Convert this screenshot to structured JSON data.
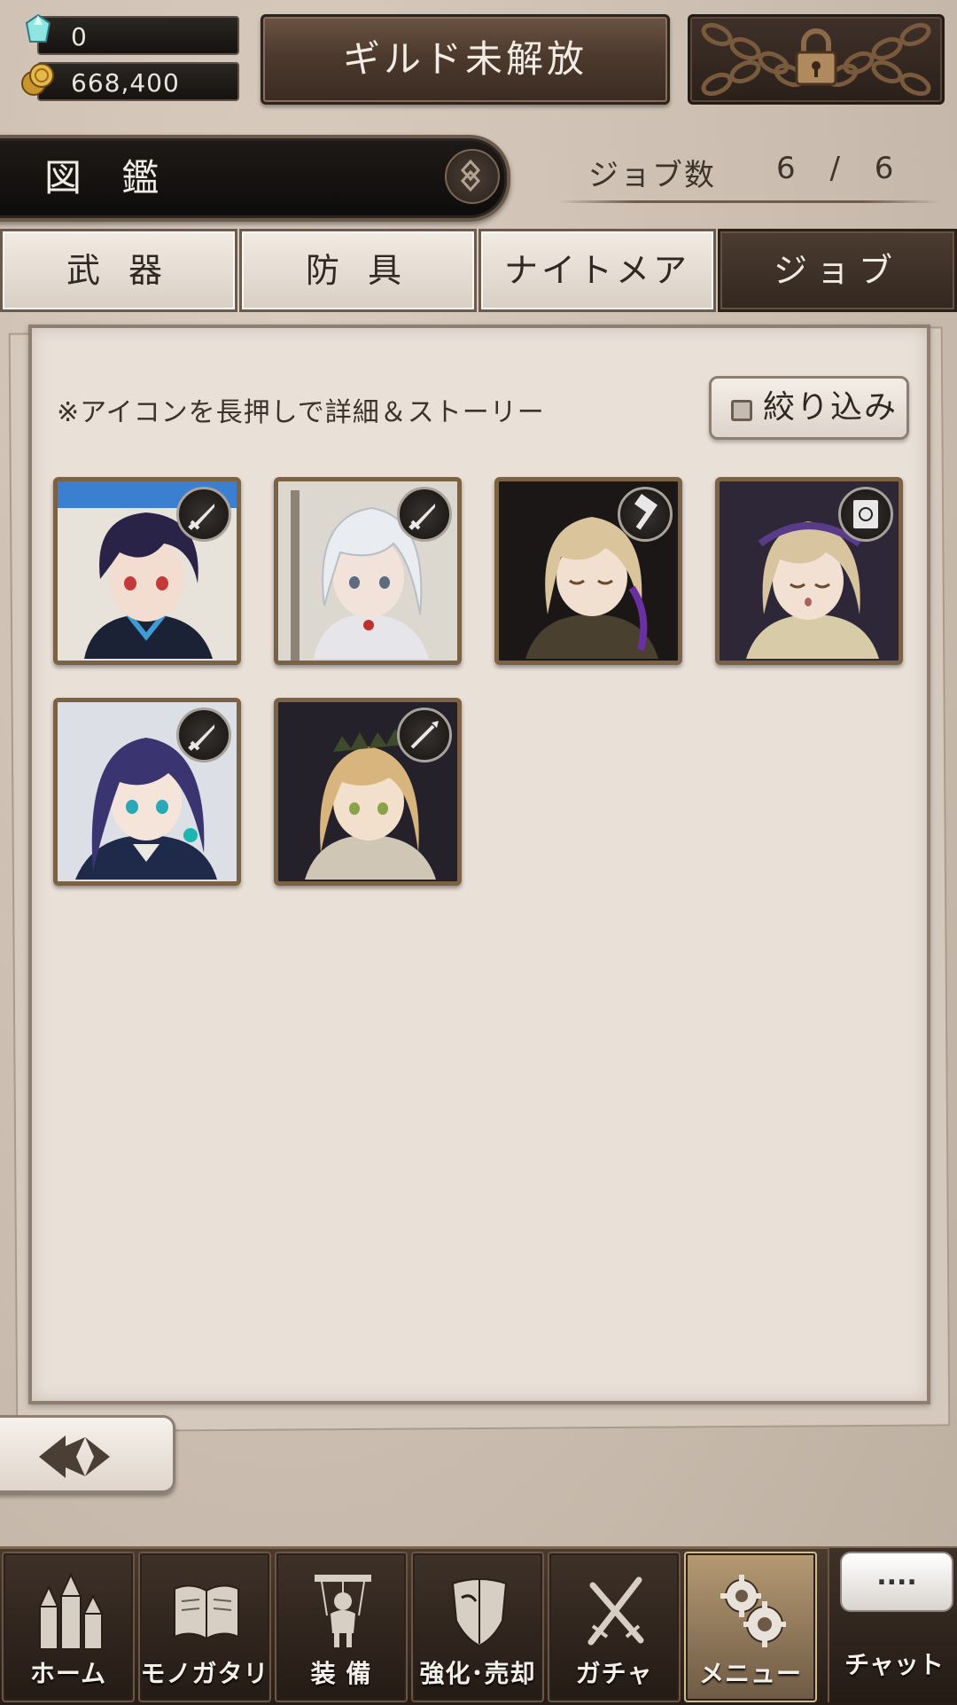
{
  "header": {
    "gems": "0",
    "coins": "668,400",
    "guild_label": "ギルド未解放",
    "locked_icon": "lock-chain-icon"
  },
  "title": {
    "section": "図 鑑",
    "count_label": "ジョブ数",
    "count_value": "6 / 6"
  },
  "tabs": [
    {
      "label": "武 器",
      "active": false
    },
    {
      "label": "防 具",
      "active": false
    },
    {
      "label": "ナイトメア",
      "active": false
    },
    {
      "label": "ジョブ",
      "active": true
    }
  ],
  "panel": {
    "hint": "※アイコンを長押しで詳細＆ストーリー",
    "filter_label": "絞り込み"
  },
  "jobs": [
    {
      "weapon": "sword-icon"
    },
    {
      "weapon": "sword-icon"
    },
    {
      "weapon": "hammer-icon"
    },
    {
      "weapon": "book-icon"
    },
    {
      "weapon": "sword-icon"
    },
    {
      "weapon": "spear-icon"
    }
  ],
  "nav": [
    {
      "label": "ホーム",
      "icon": "castle-icon",
      "active": false
    },
    {
      "label": "モノガタリ",
      "icon": "book-icon",
      "active": false
    },
    {
      "label": "装 備",
      "icon": "puppet-icon",
      "active": false
    },
    {
      "label": "強化･売却",
      "icon": "shield-icon",
      "active": false
    },
    {
      "label": "ガチャ",
      "icon": "crossed-swords-icon",
      "active": false
    },
    {
      "label": "メニュー",
      "icon": "gears-icon",
      "active": true
    }
  ],
  "chat": {
    "bubble": "....",
    "label": "チャット"
  }
}
